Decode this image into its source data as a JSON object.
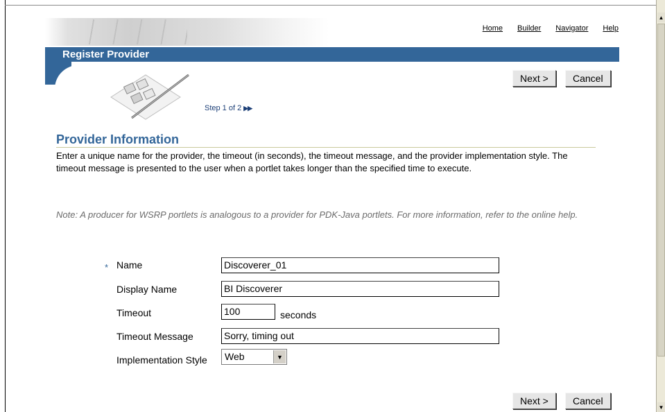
{
  "header": {
    "links": [
      "Home",
      "Builder",
      "Navigator",
      "Help"
    ],
    "title": "Register Provider"
  },
  "buttons": {
    "next": "Next >",
    "cancel": "Cancel"
  },
  "step": {
    "text": "Step 1 of 2",
    "icon": "double-arrow-icon"
  },
  "section": {
    "title": "Provider Information",
    "description": "Enter a unique name for the provider, the timeout (in seconds), the timeout message, and the provider implementation style. The timeout message is presented to the user when a portlet takes longer than the specified time to execute.",
    "note": "Note: A producer for WSRP portlets is analogous to a provider for PDK-Java portlets. For more information, refer to the online help."
  },
  "form": {
    "required_marker": "*",
    "name": {
      "label": "Name",
      "value": "Discoverer_01"
    },
    "display_name": {
      "label": "Display Name",
      "value": "BI Discoverer"
    },
    "timeout": {
      "label": "Timeout",
      "value": "100",
      "unit": "seconds"
    },
    "timeout_message": {
      "label": "Timeout Message",
      "value": "Sorry, timing out"
    },
    "implementation_style": {
      "label": "Implementation Style",
      "value": "Web"
    }
  },
  "colors": {
    "title_bar": "#336699",
    "section_title": "#336699",
    "note": "#6b6b6b"
  }
}
